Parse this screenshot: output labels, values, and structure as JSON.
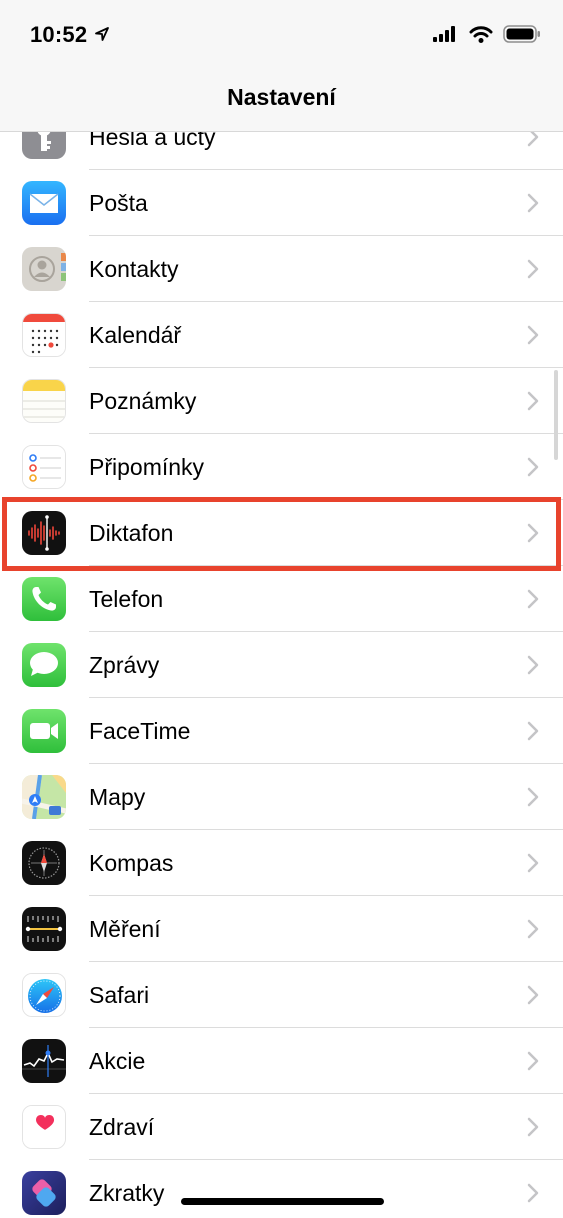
{
  "status_bar": {
    "time": "10:52",
    "icons": [
      "location-arrow-icon",
      "cellular-signal-icon",
      "wifi-icon",
      "battery-icon"
    ]
  },
  "nav": {
    "title": "Nastavení"
  },
  "settings": {
    "items": [
      {
        "label": "Hesla a účty",
        "icon": "key-icon"
      },
      {
        "label": "Pošta",
        "icon": "mail-icon"
      },
      {
        "label": "Kontakty",
        "icon": "contacts-icon"
      },
      {
        "label": "Kalendář",
        "icon": "calendar-icon"
      },
      {
        "label": "Poznámky",
        "icon": "notes-icon"
      },
      {
        "label": "Připomínky",
        "icon": "reminders-icon"
      },
      {
        "label": "Diktafon",
        "icon": "voice-memos-icon"
      },
      {
        "label": "Telefon",
        "icon": "phone-icon"
      },
      {
        "label": "Zprávy",
        "icon": "messages-icon"
      },
      {
        "label": "FaceTime",
        "icon": "facetime-icon"
      },
      {
        "label": "Mapy",
        "icon": "maps-icon"
      },
      {
        "label": "Kompas",
        "icon": "compass-icon"
      },
      {
        "label": "Měření",
        "icon": "measure-icon"
      },
      {
        "label": "Safari",
        "icon": "safari-icon"
      },
      {
        "label": "Akcie",
        "icon": "stocks-icon"
      },
      {
        "label": "Zdraví",
        "icon": "health-icon"
      },
      {
        "label": "Zkratky",
        "icon": "shortcuts-icon"
      }
    ]
  },
  "highlight": {
    "item": "Diktafon",
    "color": "#e8432d"
  }
}
